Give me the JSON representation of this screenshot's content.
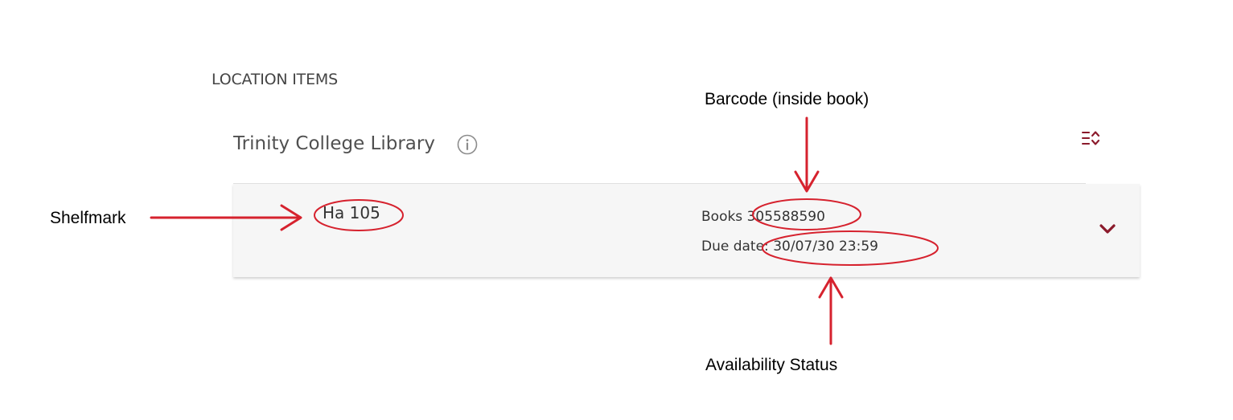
{
  "section": {
    "title": "LOCATION ITEMS"
  },
  "library": {
    "name": "Trinity College Library",
    "info_icon": "info-icon",
    "sort_icon": "sort-list-icon"
  },
  "item": {
    "shelfmark": "Ha 105",
    "books_label": "Books",
    "barcode": "305588590",
    "due_label": "Due date:",
    "due_value": "30/07/30 23:59",
    "expand_icon": "chevron-down-icon"
  },
  "annotations": {
    "shelfmark": "Shelfmark",
    "barcode": "Barcode (inside book)",
    "availability": "Availability Status",
    "color": "#d6222e"
  },
  "colors": {
    "accent": "#8b1a2b",
    "card_background": "#f6f6f6"
  }
}
